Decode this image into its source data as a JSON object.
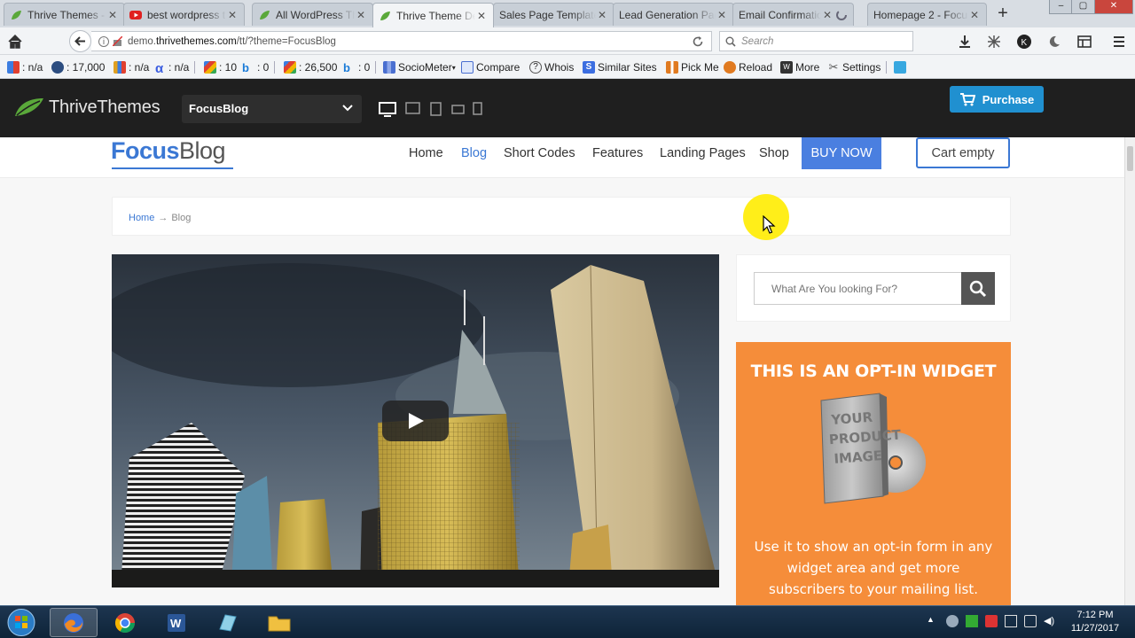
{
  "browser": {
    "tabs": [
      {
        "label": "Thrive Themes - ",
        "icon": "leaf-icon"
      },
      {
        "label": "best wordpress t",
        "icon": "youtube-icon"
      },
      {
        "label": "All WordPress Th",
        "icon": "leaf-icon"
      },
      {
        "label": "Thrive Theme De",
        "icon": "leaf-icon",
        "active": true
      },
      {
        "label": "Sales Page Template",
        "icon": "none"
      },
      {
        "label": "Lead Generation Pag",
        "icon": "none"
      },
      {
        "label": "Email Confirmation",
        "icon": "spinner-icon"
      },
      {
        "label": "Homepage 2 - Focus",
        "icon": "none"
      }
    ],
    "url_prefix": "demo.",
    "url_host": "thrivethemes.com",
    "url_path": "/tt/?theme=FocusBlog",
    "search_placeholder": "Search",
    "bookmarks": [
      {
        "label": ": n/a",
        "icon": "google-pr-icon"
      },
      {
        "label": ": 17,000",
        "icon": "alexa-icon"
      },
      {
        "label": ": n/a",
        "icon": "bar-icon"
      },
      {
        "label": ": n/a",
        "icon": "alpha-icon"
      },
      {
        "label": ": 10",
        "icon": "google-index-icon"
      },
      {
        "label": ": 0",
        "icon": "bing-icon"
      },
      {
        "label": ": 26,500",
        "icon": "google-index-icon"
      },
      {
        "label": ": 0",
        "icon": "bing-icon"
      },
      {
        "label": "SocioMeter",
        "icon": "sociometer-icon"
      },
      {
        "label": "Compare",
        "icon": "compare-icon"
      },
      {
        "label": "Whois",
        "icon": "whois-icon"
      },
      {
        "label": "Similar Sites",
        "icon": "similar-sites-icon"
      },
      {
        "label": "Pick Me",
        "icon": "pick-me-icon"
      },
      {
        "label": "Reload",
        "icon": "reload-icon"
      },
      {
        "label": "More",
        "icon": "more-icon"
      },
      {
        "label": "Settings",
        "icon": "settings-icon"
      }
    ]
  },
  "thrive_bar": {
    "logo_thrive": "Thrive",
    "logo_themes": "Themes",
    "theme_selected": "FocusBlog",
    "purchase_label": "Purchase"
  },
  "site": {
    "logo_focus": "Focus",
    "logo_blog": "Blog",
    "menu": [
      "Home",
      "Blog",
      "Short Codes",
      "Features",
      "Landing Pages",
      "Shop"
    ],
    "active_menu": "Blog",
    "buy_now": "BUY NOW",
    "cart": "Cart empty",
    "breadcrumb_home": "Home",
    "breadcrumb_arrow": "→",
    "breadcrumb_current": "Blog",
    "search_placeholder": "What Are You looking For?",
    "optin_title": "THIS IS AN OPT-IN WIDGET",
    "optin_image_text": "YOUR PRODUCT IMAGE",
    "optin_cd_text": "PRODUCT IMAGE",
    "optin_text": "Use it to show an opt-in form in any widget area and get more subscribers to your mailing list."
  },
  "taskbar": {
    "time": "7:12 PM",
    "date": "11/27/2017"
  },
  "colors": {
    "accent": "#3b78d4",
    "purchase": "#2090d0",
    "optin": "#f58d3a",
    "thrive_bar": "#1f1f1f"
  }
}
